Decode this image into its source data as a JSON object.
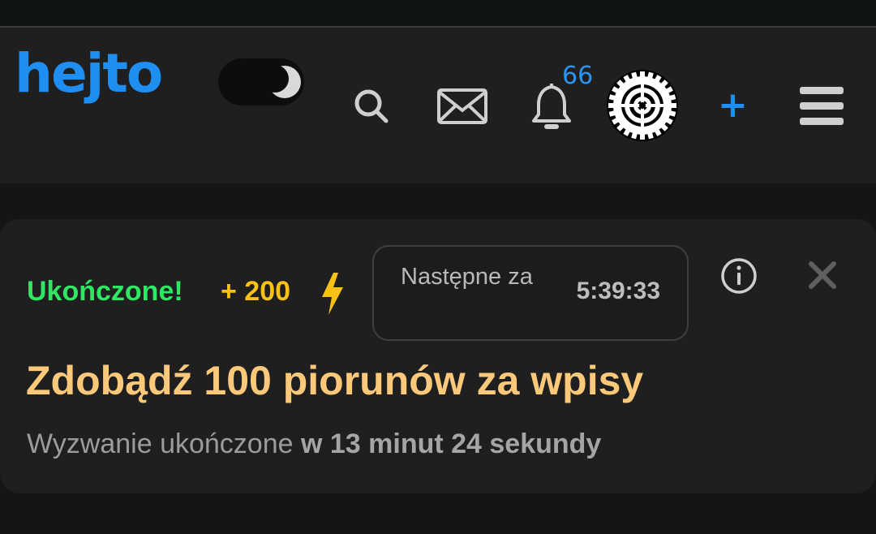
{
  "header": {
    "logo_text": "hejto",
    "notifications_count": "66",
    "add_label": "+",
    "brand_color": "#1e8ff0"
  },
  "icons": {
    "theme_toggle": "moon-icon",
    "search": "search-icon",
    "messages": "envelope-icon",
    "notifications": "bell-icon",
    "avatar": "gear-avatar",
    "menu": "hamburger-icon",
    "info": "info-icon",
    "close": "close-icon",
    "lightning": "lightning-icon"
  },
  "challenge": {
    "status": "Ukończone!",
    "reward": "+ 200",
    "next_label": "Następne za",
    "next_time": "5:39:33",
    "title": "Zdobądź 100 piorunów za wpisy",
    "subtitle_prefix": "Wyzwanie ukończone",
    "subtitle_duration": "w 13 minut 24 sekundy",
    "status_color": "#2ee863",
    "reward_color": "#f7c215",
    "title_color": "#fcc97a"
  }
}
